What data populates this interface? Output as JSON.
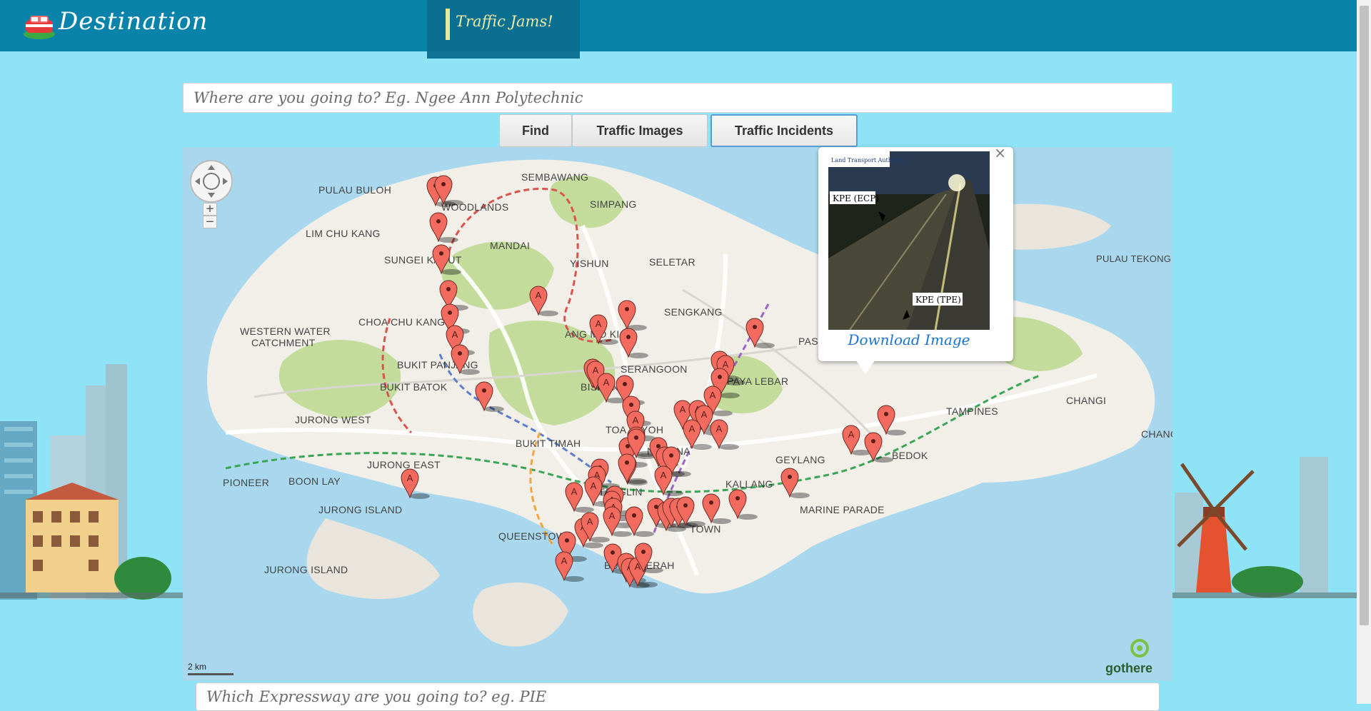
{
  "header": {
    "brand": "Destination",
    "nav_tab_label": "Traffic Jams!",
    "logo_icon": "red-car-icon"
  },
  "search": {
    "placeholder": "Where are you going to? Eg. Ngee Ann Polytechnic"
  },
  "buttons": {
    "find": "Find",
    "traffic_images": "Traffic Images",
    "traffic_incidents": "Traffic Incidents"
  },
  "map": {
    "places": [
      "PULAU BULOH",
      "SEMBAWANG",
      "WOODLANDS",
      "SIMPANG",
      "LIM CHU KANG",
      "MANDAI",
      "SUNGEI KADUT",
      "YISHUN",
      "SELETAR",
      "PULAU TEKONG",
      "WESTERN WATER",
      "CATCHMENT",
      "CHOA CHU KANG",
      "SENGKANG",
      "ANG MO KIO",
      "PASIR RIS",
      "BUKIT PANJANG",
      "SERANGOON",
      "PAYA LEBAR",
      "BUKIT BATOK",
      "BISHAN",
      "CHANGI",
      "JURONG WEST",
      "TOA PAYOH",
      "TAMPINES",
      "BUKIT TIMAH",
      "NOVENA",
      "CHANG",
      "GEYLANG",
      "JURONG EAST",
      "BEDOK",
      "PIONEER",
      "BOON LAY",
      "KALLANG",
      "TANGLIN",
      "JURONG ISLAND",
      "MARINE PARADE",
      "TOWN",
      "QUEENSTOWN",
      "BUKIT MERAH",
      "JURONG ISLAND"
    ],
    "scale_label": "2 km",
    "brand_logo": "gothere",
    "zoom_in": "+",
    "zoom_out": "−",
    "accent_colors": {
      "land": "#f2efe9",
      "park": "#c3dc9c",
      "water": "#a9d8ee",
      "marker": "#f36b5f"
    }
  },
  "popup": {
    "close": "×",
    "camera_labels": [
      "KPE (ECP)",
      "KPE (TPE)"
    ],
    "camera_logo": "Land Transport Authority",
    "download_label": "Download Image"
  },
  "expressway": {
    "placeholder": "Which Expressway are you going to? eg. PIE"
  }
}
